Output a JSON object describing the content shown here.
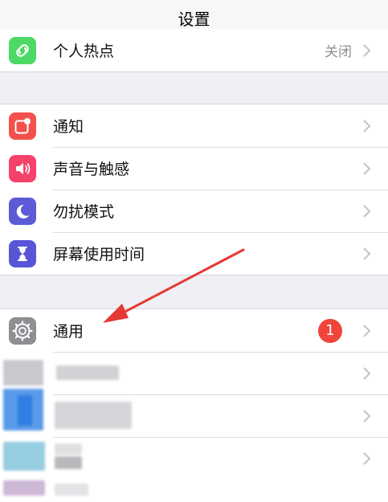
{
  "navbar": {
    "title": "设置"
  },
  "hotspot_group": {
    "items": [
      {
        "label": "个人热点",
        "value": "关闭",
        "icon": "hotspot-icon",
        "color": "#4cd964"
      }
    ]
  },
  "notify_group": {
    "items": [
      {
        "label": "通知",
        "icon": "notifications-icon",
        "color": "#f2514b"
      },
      {
        "label": "声音与触感",
        "icon": "speaker-icon",
        "color": "#f5426b"
      },
      {
        "label": "勿扰模式",
        "icon": "moon-icon",
        "color": "#5b5bd6"
      },
      {
        "label": "屏幕使用时间",
        "icon": "hourglass-icon",
        "color": "#5856d6"
      }
    ]
  },
  "general_group": {
    "items": [
      {
        "label": "通用",
        "badge": "1",
        "icon": "gear-icon",
        "color": "#8e8e93",
        "badge_color": "#f0453a"
      }
    ]
  },
  "annotation": {
    "arrow_color": "#e53935"
  }
}
